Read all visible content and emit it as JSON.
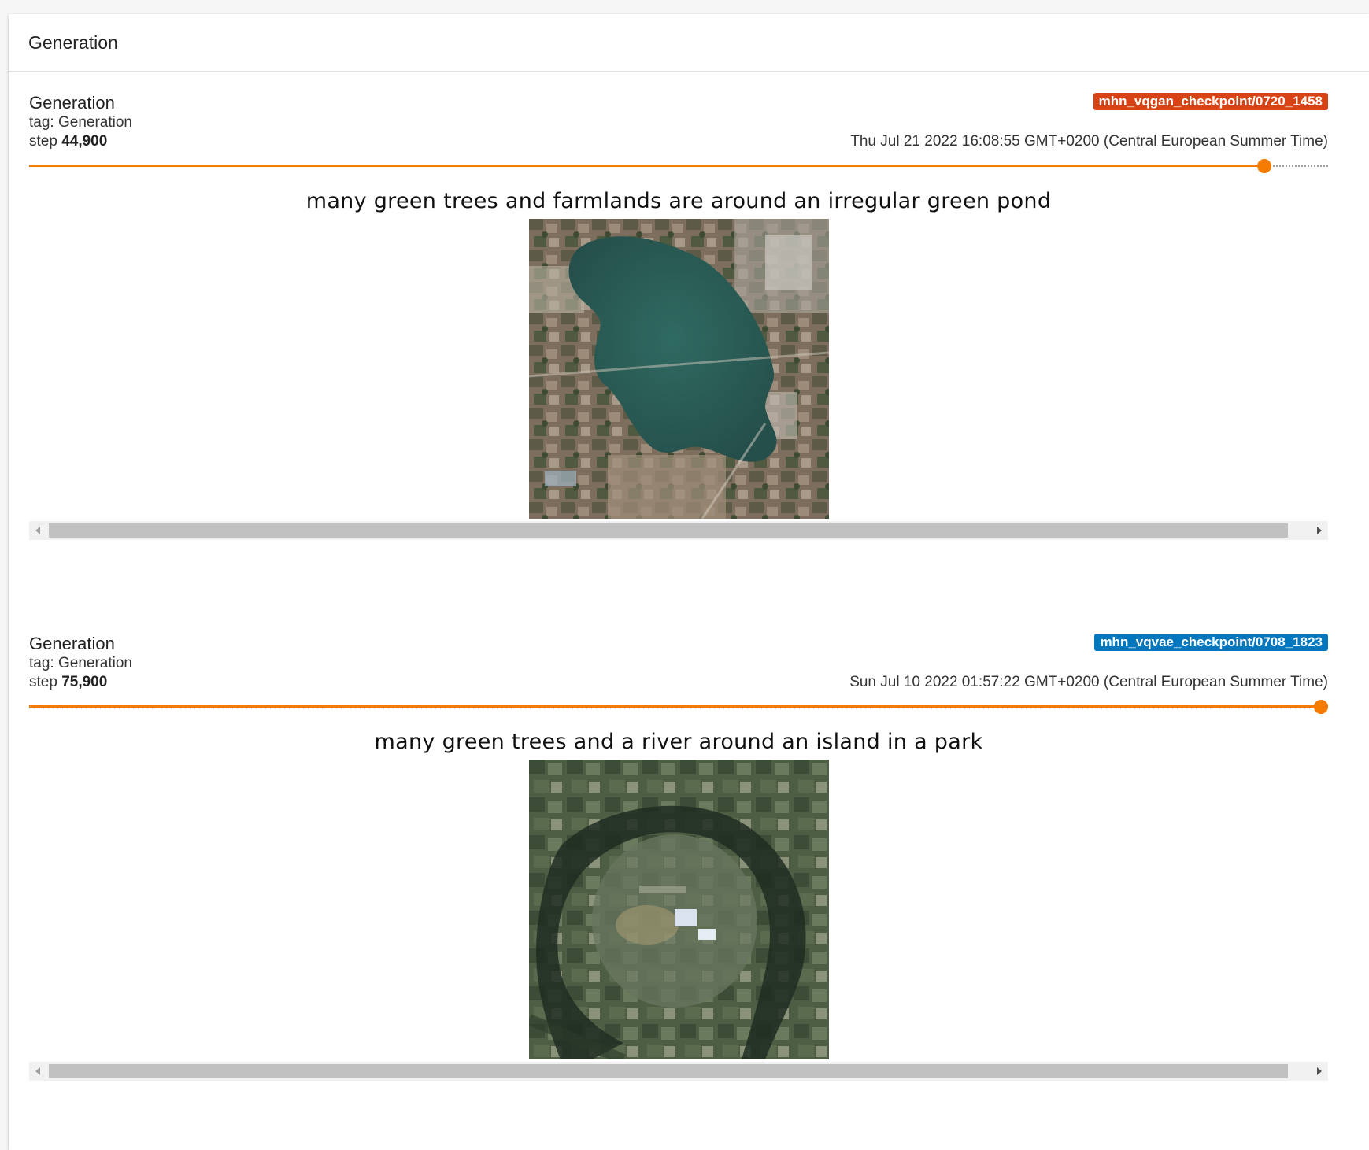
{
  "panel": {
    "title": "Generation"
  },
  "cards": [
    {
      "title": "Generation",
      "tag_label": "tag: Generation",
      "step_prefix": "step",
      "step_value": "44,900",
      "run_name": "mhn_vqgan_checkpoint/0720_1458",
      "run_color": "#d84315",
      "timestamp": "Thu Jul 21 2022 16:08:55 GMT+0200 (Central European Summer Time)",
      "slider_fraction": 0.951,
      "image_caption": "many green trees and farmlands are around an irregular green pond"
    },
    {
      "title": "Generation",
      "tag_label": "tag: Generation",
      "step_prefix": "step",
      "step_value": "75,900",
      "run_name": "mhn_vqvae_checkpoint/0708_1823",
      "run_color": "#0277bd",
      "timestamp": "Sun Jul 10 2022 01:57:22 GMT+0200 (Central European Summer Time)",
      "slider_fraction": 1.0,
      "image_caption": "many green trees and a river around an island in a park"
    }
  ],
  "colors": {
    "slider_accent": "#f57c00"
  },
  "icons": {
    "scroll_left": "triangle-left",
    "scroll_right": "triangle-right"
  }
}
